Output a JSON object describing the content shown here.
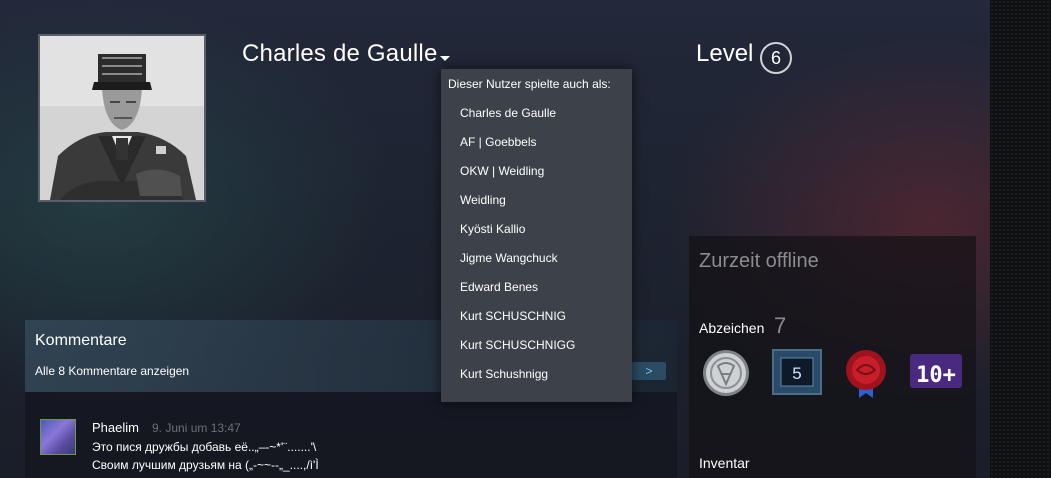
{
  "profile": {
    "persona_name": "Charles de Gaulle",
    "level_label": "Level",
    "level_value": "6"
  },
  "aliases_dropdown": {
    "title": "Dieser Nutzer spielte auch als:",
    "items": [
      "Charles de Gaulle",
      "AF | Goebbels",
      "OKW | Weidling",
      "Weidling",
      "Kyösti Kallio",
      "Jigme Wangchuck",
      "Edward Benes",
      "Kurt SCHUSCHNIG",
      "Kurt SCHUSCHNIGG",
      "Kurt Schushnigg"
    ]
  },
  "status": {
    "text": "Zurzeit offline",
    "badges_label": "Abzeichen",
    "badges_count": "7",
    "badges": [
      {
        "name": "silver-coin-badge-icon",
        "value": ""
      },
      {
        "name": "years-of-service-badge-icon",
        "value": "5"
      },
      {
        "name": "wax-seal-badge-icon",
        "value": ""
      },
      {
        "name": "ten-plus-badge-icon",
        "value": "10+"
      }
    ],
    "inventory_label": "Inventar"
  },
  "comments": {
    "title": "Kommentare",
    "view_all": "Alle 8 Kommentare anzeigen",
    "arrow": ">",
    "entries": [
      {
        "author": "Phaelim",
        "time": "9. Juni um 13:47",
        "lines": [
          "Это пися дружбы добавь её..„–-~*'¨.......'\\",
          "Своим лучшим друзьям на („-~~--„_....,/ì'Ì"
        ]
      }
    ]
  },
  "colors": {
    "dropdown_bg": "#3d4149",
    "muted_text": "#8a8c90",
    "link_blue": "#7fc4ef"
  }
}
